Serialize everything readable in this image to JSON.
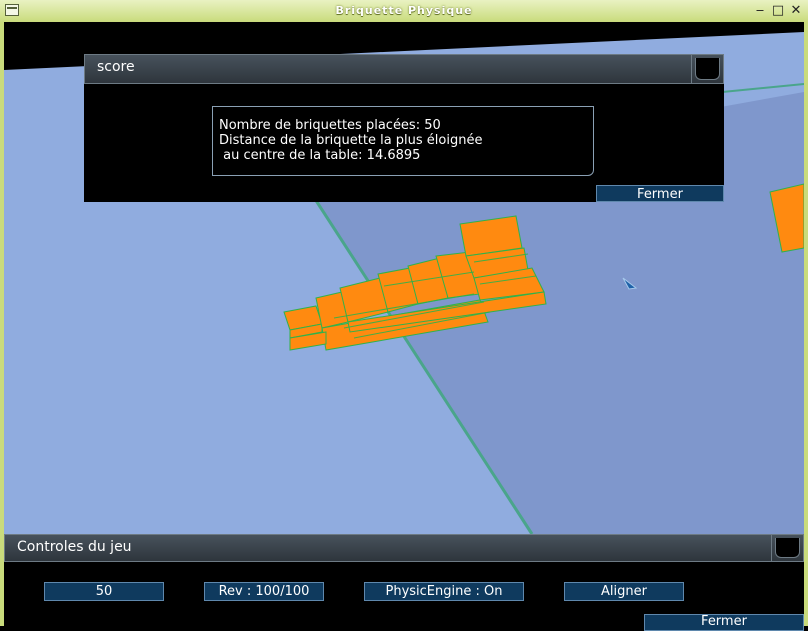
{
  "window": {
    "title": "Briquette Physique"
  },
  "score_panel": {
    "title": "score",
    "lines": [
      "Nombre de briquettes placées: 50",
      "Distance de la briquette la plus éloignée",
      " au centre de la table: 14.6895"
    ],
    "close_label": "Fermer"
  },
  "controls_panel": {
    "title": "Controles du jeu",
    "count_value": "50",
    "rev_label": "Rev : 100/100",
    "physics_label": "PhysicEngine : On",
    "align_label": "Aligner",
    "close_label": "Fermer"
  },
  "colors": {
    "table_light": "#90acdf",
    "table_dark": "#7f97cc",
    "brick": "#ff8a10",
    "brick_edge": "#31b24a",
    "table_edge": "#4aa58b",
    "button_fill": "#0f3a5e"
  },
  "icons": [
    "window-menu-icon",
    "minimize-icon",
    "maximize-icon",
    "close-icon",
    "mouse-cursor-icon"
  ]
}
